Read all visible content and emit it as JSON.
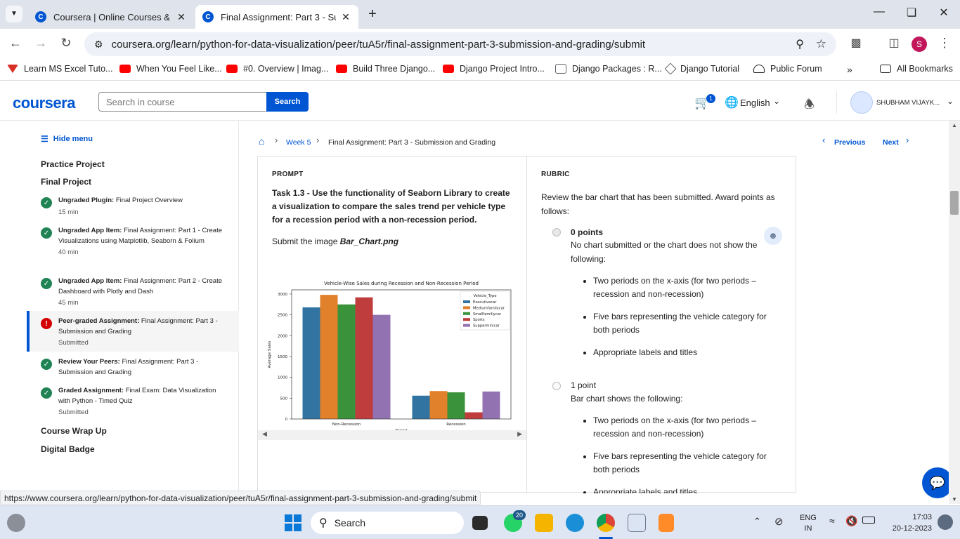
{
  "browser": {
    "tabs": [
      {
        "title": "Coursera | Online Courses & Cr",
        "active": false
      },
      {
        "title": "Final Assignment: Part 3 - Subm",
        "active": true
      }
    ],
    "url": "coursera.org/learn/python-for-data-visualization/peer/tuA5r/final-assignment-part-3-submission-and-grading/submit",
    "bookmarks": [
      {
        "label": "Learn MS Excel Tuto...",
        "color": "#d93025"
      },
      {
        "label": "When You Feel Like...",
        "color": "#ff0000"
      },
      {
        "label": "#0. Overview | Imag...",
        "color": "#ff0000"
      },
      {
        "label": "Build Three Django...",
        "color": "#ff0000"
      },
      {
        "label": "Django Project Intro...",
        "color": "#ff0000"
      },
      {
        "label": "Django Packages : R...",
        "color": "#5f6368"
      },
      {
        "label": "Django Tutorial",
        "color": "#5f6368"
      },
      {
        "label": "Public Forum",
        "color": "#1f1f1f"
      }
    ],
    "all_bookmarks": "All Bookmarks",
    "profile_initial": "S"
  },
  "header": {
    "logo": "coursera",
    "search_placeholder": "Search in course",
    "search_button": "Search",
    "cart_count": "1",
    "language": "English",
    "user_name": "SHUBHAM VIJAYK..."
  },
  "sidebar": {
    "hide_menu": "Hide menu",
    "modules": [
      "Practice Project",
      "Final Project",
      "Course Wrap Up",
      "Digital Badge"
    ],
    "items": [
      {
        "type": "Ungraded Plugin:",
        "title": "Final Project Overview",
        "sub": "15 min",
        "status": "done"
      },
      {
        "type": "Ungraded App Item:",
        "title": "Final Assignment: Part 1 - Create Visualizations using Matplotlib, Seaborn & Folium",
        "sub": "40 min",
        "status": "done"
      },
      {
        "type": "Ungraded App Item:",
        "title": "Final Assignment: Part 2 - Create Dashboard with Plotly and Dash",
        "sub": "45 min",
        "status": "done"
      },
      {
        "type": "Peer-graded Assignment:",
        "title": "Final Assignment: Part 3 - Submission and Grading",
        "sub": "Submitted",
        "status": "error"
      },
      {
        "type": "Review Your Peers:",
        "title": "Final Assignment: Part 3 - Submission and Grading",
        "sub": "",
        "status": "done"
      },
      {
        "type": "Graded Assignment:",
        "title": "Final Exam: Data Visualization with Python - Timed Quiz",
        "sub": "Submitted",
        "status": "done"
      }
    ]
  },
  "breadcrumb": {
    "week": "Week 5",
    "page": "Final Assignment: Part 3 - Submission and Grading",
    "previous": "Previous",
    "next": "Next"
  },
  "prompt": {
    "label": "PROMPT",
    "task": "Task 1.3 - Use the functionality of Seaborn Library to create a visualization to compare the sales trend per vehicle type for a recession period with a non-recession period.",
    "submit_prefix": "Submit the image ",
    "submit_file": "Bar_Chart.png"
  },
  "rubric": {
    "label": "RUBRIC",
    "intro": "Review the bar chart that has been submitted. Award points as follows:",
    "options": [
      {
        "points": "0 points",
        "desc": "No chart submitted or the chart does not show the following:",
        "criteria": [
          "Two periods on the x-axis (for two periods – recession and non-recession)",
          "Five bars representing the vehicle category for both periods",
          "Appropriate labels and titles"
        ]
      },
      {
        "points": "1 point",
        "desc": "Bar chart shows the following:",
        "criteria": [
          "Two periods on the x-axis (for two periods – recession and non-recession)",
          "Five bars representing the vehicle category for both periods",
          "Appropriate labels and titles"
        ]
      }
    ]
  },
  "status_url": "https://www.coursera.org/learn/python-for-data-visualization/peer/tuA5r/final-assignment-part-3-submission-and-grading/submit",
  "taskbar": {
    "search": "Search",
    "whatsapp_badge": "20",
    "lang_top": "ENG",
    "lang_bottom": "IN",
    "time": "17:03",
    "date": "20-12-2023"
  },
  "chart_data": {
    "type": "bar",
    "title": "Vehicle-Wise Sales during Recession and Non-Recession Period",
    "xlabel": "Period",
    "ylabel": "Average Sales",
    "categories": [
      "Non-Recession",
      "Recession"
    ],
    "ylim": [
      0,
      3100
    ],
    "yticks": [
      0,
      500,
      1000,
      1500,
      2000,
      2500,
      3000
    ],
    "legend_title": "Vehicle_Type",
    "legend_position": "top-right",
    "series": [
      {
        "name": "Executivecar",
        "color": "#3274a1",
        "values": [
          2680,
          560
        ]
      },
      {
        "name": "Mediumfamilycar",
        "color": "#e1812c",
        "values": [
          2980,
          670
        ]
      },
      {
        "name": "Smallfamiliycar",
        "color": "#3a923a",
        "values": [
          2750,
          640
        ]
      },
      {
        "name": "Sports",
        "color": "#c03d3e",
        "values": [
          2920,
          160
        ]
      },
      {
        "name": "Supperminicar",
        "color": "#9372b2",
        "values": [
          2500,
          660
        ]
      }
    ]
  }
}
